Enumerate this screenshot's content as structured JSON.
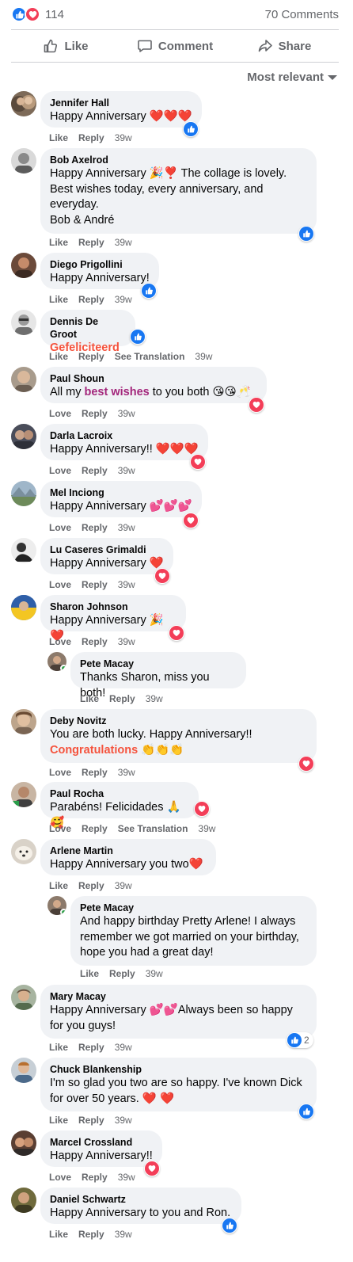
{
  "summary": {
    "reaction_count": "114",
    "comments_count": "70 Comments",
    "icons": [
      "like-icon",
      "love-icon"
    ]
  },
  "actions": {
    "like": "Like",
    "comment": "Comment",
    "share": "Share"
  },
  "sort": {
    "label": "Most relevant"
  },
  "colors": {
    "like_blue": "#1877f2",
    "love_red": "#f33e58",
    "bubble_bg": "#f0f2f5",
    "muted_text": "#65676b",
    "orange_text": "#f5533d",
    "purple_text": "#a3267b"
  },
  "comments": [
    {
      "author": "Jennifer Hall",
      "line1": "Happy Anniversary ❤️❤️❤️",
      "like": "Like",
      "reply": "Reply",
      "time": "39w",
      "reaction": "like"
    },
    {
      "author": "Bob Axelrod",
      "line1": "Happy Anniversary 🎉❣️ The collage is lovely.",
      "line2": "Best wishes today, every anniversary, and",
      "line3": "everyday.",
      "line4": "Bob & André",
      "like": "Like",
      "reply": "Reply",
      "time": "39w",
      "reaction": "like"
    },
    {
      "author": "Diego Prigollini",
      "line1": "Happy Anniversary!",
      "like": "Like",
      "reply": "Reply",
      "time": "39w",
      "reaction": "like"
    },
    {
      "author": "Dennis De Groot",
      "line1": "Gefeliciteerd",
      "like": "Like",
      "reply": "Reply",
      "translate": "See Translation",
      "time": "39w",
      "reaction": "like"
    },
    {
      "author": "Paul Shoun",
      "pre": "All my ",
      "highlight": "best wishes",
      "post": " to you both 😘😘🥂",
      "like": "Love",
      "reply": "Reply",
      "time": "39w",
      "reaction": "love"
    },
    {
      "author": "Darla Lacroix",
      "line1": "Happy Anniversary!! ❤️❤️❤️",
      "like": "Love",
      "reply": "Reply",
      "time": "39w",
      "reaction": "love"
    },
    {
      "author": "Mel Inciong",
      "line1": "Happy Anniversary 💕💕💕",
      "like": "Love",
      "reply": "Reply",
      "time": "39w",
      "reaction": "love"
    },
    {
      "author": "Lu Caseres Grimaldi",
      "line1": "Happy Anniversary ❤️",
      "like": "Love",
      "reply": "Reply",
      "time": "39w",
      "reaction": "love"
    },
    {
      "author": "Sharon Johnson",
      "line1": "Happy Anniversary 🎉❤️",
      "like": "Love",
      "reply": "Reply",
      "time": "39w",
      "reaction": "love"
    },
    {
      "author": "Pete Macay",
      "line1": "Thanks Sharon, miss you both!",
      "like": "Like",
      "reply": "Reply",
      "time": "39w",
      "reply_to": "Sharon Johnson"
    },
    {
      "author": "Deby Novitz",
      "line1": "You are both lucky. Happy Anniversary!!",
      "line2": "Congratulations 👏👏👏",
      "like": "Love",
      "reply": "Reply",
      "time": "39w",
      "reaction": "love"
    },
    {
      "author": "Paul Rocha",
      "line1": "Parabéns! Felicidades 🙏🥰",
      "like": "Love",
      "reply": "Reply",
      "translate": "See Translation",
      "time": "39w",
      "reaction": "love"
    },
    {
      "author": "Arlene Martin",
      "line1": "Happy Anniversary you two❤️",
      "like": "Like",
      "reply": "Reply",
      "time": "39w"
    },
    {
      "author": "Pete Macay",
      "line1": "And happy birthday Pretty Arlene! I always",
      "line2": "remember we got married on your birthday,",
      "line3": "hope you had a great day!",
      "like": "Like",
      "reply": "Reply",
      "time": "39w",
      "reply_to": "Arlene Martin"
    },
    {
      "author": "Mary Macay",
      "line1": "Happy Anniversary 💕💕Always been so happy",
      "line2": "for you guys!",
      "like": "Like",
      "reply": "Reply",
      "time": "39w",
      "reaction": "like",
      "reaction_count": "2"
    },
    {
      "author": "Chuck Blankenship",
      "line1": "I'm so glad you two are so happy. I've known Dick",
      "line2": "for over 50 years. ❤️ ❤️",
      "like": "Like",
      "reply": "Reply",
      "time": "39w",
      "reaction": "like"
    },
    {
      "author": "Marcel Crossland",
      "line1": "Happy Anniversary!!",
      "like": "Love",
      "reply": "Reply",
      "time": "39w",
      "reaction": "love"
    },
    {
      "author": "Daniel Schwartz",
      "line1": "Happy Anniversary to you and Ron.",
      "like": "Like",
      "reply": "Reply",
      "time": "39w",
      "reaction": "like"
    }
  ]
}
